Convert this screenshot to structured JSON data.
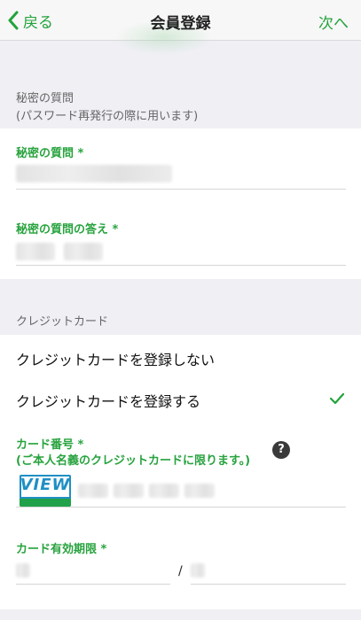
{
  "nav": {
    "back_label": "戻る",
    "title": "会員登録",
    "next_label": "次へ"
  },
  "secret": {
    "section_title": "秘密の質問",
    "section_sub": "(パスワード再発行の際に用います)",
    "question_label": "秘密の質問 *",
    "answer_label": "秘密の質問の答え *"
  },
  "credit": {
    "section_title": "クレジットカード",
    "option_no": "クレジットカードを登録しない",
    "option_yes": "クレジットカードを登録する",
    "selected": "option_yes",
    "card_number_label": "カード番号 *",
    "card_number_note": "(ご本人名義のクレジットカードに限ります。)",
    "help_glyph": "?",
    "card_brand": "VIEW",
    "expiry_label": "カード有効期限 *",
    "expiry_separator": "/"
  },
  "colors": {
    "accent": "#22a33a",
    "background": "#efeff4"
  }
}
